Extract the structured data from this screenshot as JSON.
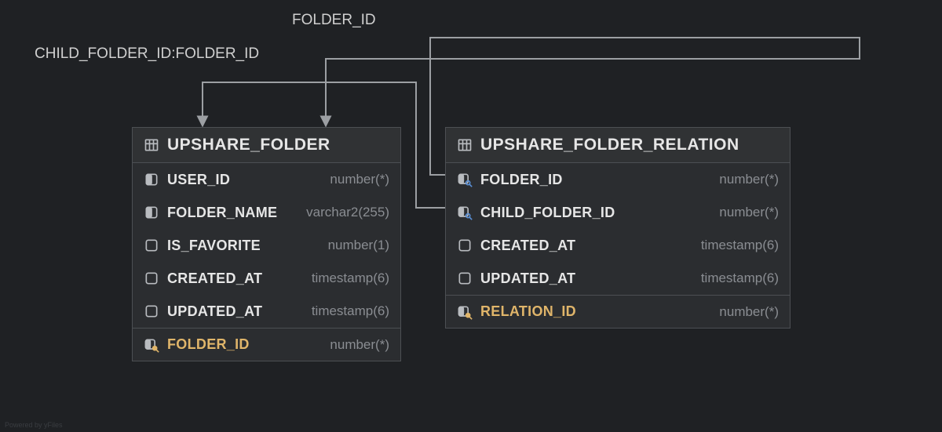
{
  "labels": {
    "rel1": "FOLDER_ID",
    "rel2": "CHILD_FOLDER_ID:FOLDER_ID"
  },
  "tableA": {
    "title": "UPSHARE_FOLDER",
    "cols": [
      {
        "name": "USER_ID",
        "type": "number(*)"
      },
      {
        "name": "FOLDER_NAME",
        "type": "varchar2(255)"
      },
      {
        "name": "IS_FAVORITE",
        "type": "number(1)"
      },
      {
        "name": "CREATED_AT",
        "type": "timestamp(6)"
      },
      {
        "name": "UPDATED_AT",
        "type": "timestamp(6)"
      }
    ],
    "pk": {
      "name": "FOLDER_ID",
      "type": "number(*)"
    }
  },
  "tableB": {
    "title": "UPSHARE_FOLDER_RELATION",
    "cols": [
      {
        "name": "FOLDER_ID",
        "type": "number(*)"
      },
      {
        "name": "CHILD_FOLDER_ID",
        "type": "number(*)"
      },
      {
        "name": "CREATED_AT",
        "type": "timestamp(6)"
      },
      {
        "name": "UPDATED_AT",
        "type": "timestamp(6)"
      }
    ],
    "pk": {
      "name": "RELATION_ID",
      "type": "number(*)"
    }
  },
  "footnote": "Powered by yFiles"
}
